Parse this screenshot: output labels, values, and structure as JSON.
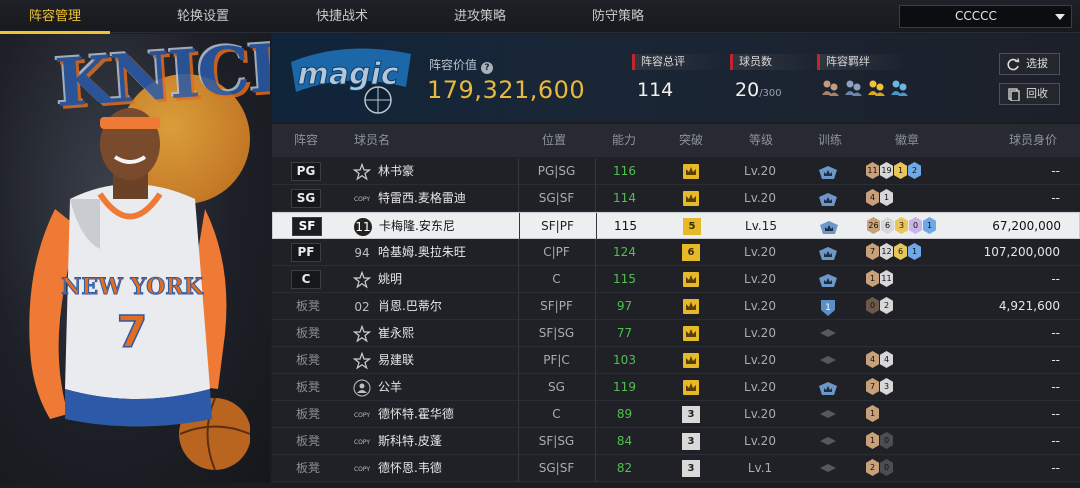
{
  "nav": {
    "tabs": [
      "阵容管理",
      "轮换设置",
      "快捷战术",
      "进攻策略",
      "防守策略"
    ],
    "active": 0,
    "team_select": "CCCCC"
  },
  "team": {
    "logo_text": "magic",
    "value_label": "阵容价值",
    "value": "179,321,600",
    "rating_label": "阵容总评",
    "rating": "114",
    "players_label": "球员数",
    "players_count": "20",
    "players_max": "/300",
    "bond_label": "阵容羁绊",
    "bond_icons": [
      "bond-gray-icon",
      "bond-blue-icon",
      "bond-yellow-icon",
      "bond-blue-icon"
    ],
    "btn_select": "选拔",
    "btn_recycle": "回收"
  },
  "table": {
    "headers": [
      "阵容",
      "球员名",
      "位置",
      "能力",
      "突破",
      "等级",
      "训练",
      "徽章",
      "球员身价"
    ],
    "rows": [
      {
        "slot": "PG",
        "icon": "star",
        "name": "林书豪",
        "pos": "PG|SG",
        "ability": "116",
        "break": "crown",
        "level": "Lv.20",
        "train": "blue",
        "badges": [
          [
            "11",
            "#c8a07a"
          ],
          [
            "19",
            "#d7d7d7"
          ],
          [
            "1",
            "#e8c65a"
          ],
          [
            "2",
            "#6ea8e6"
          ]
        ],
        "salary": "--"
      },
      {
        "slot": "SG",
        "icon": "copy",
        "name": "特雷西.麦格雷迪",
        "pos": "SG|SF",
        "ability": "114",
        "break": "crown",
        "level": "Lv.20",
        "train": "blue",
        "badges": [
          [
            "4",
            "#c8a07a"
          ],
          [
            "1",
            "#d7d7d7"
          ]
        ],
        "salary": "--"
      },
      {
        "slot": "SF",
        "icon": "11",
        "name": "卡梅隆.安东尼",
        "pos": "SF|PF",
        "ability": "115",
        "break": "5",
        "level": "Lv.15",
        "train": "blue",
        "badges": [
          [
            "26",
            "#c8a07a"
          ],
          [
            "6",
            "#d7d7d7"
          ],
          [
            "3",
            "#e8c65a"
          ],
          [
            "0",
            "#c9b6e8"
          ],
          [
            "1",
            "#6ea8e6"
          ]
        ],
        "salary": "67,200,000"
      },
      {
        "slot": "PF",
        "icon": "94",
        "name": "哈基姆.奥拉朱旺",
        "pos": "C|PF",
        "ability": "124",
        "break": "6",
        "level": "Lv.20",
        "train": "blue",
        "badges": [
          [
            "7",
            "#c8a07a"
          ],
          [
            "12",
            "#d7d7d7"
          ],
          [
            "6",
            "#e8c65a"
          ],
          [
            "1",
            "#6ea8e6"
          ]
        ],
        "salary": "107,200,000"
      },
      {
        "slot": "C",
        "icon": "star",
        "name": "姚明",
        "pos": "C",
        "ability": "115",
        "break": "crown",
        "level": "Lv.20",
        "train": "blue",
        "badges": [
          [
            "1",
            "#c8a07a"
          ],
          [
            "11",
            "#d7d7d7"
          ]
        ],
        "salary": "--"
      },
      {
        "slot": "板凳",
        "icon": "02",
        "name": "肖恩.巴蒂尔",
        "pos": "SF|PF",
        "ability": "97",
        "break": "crown",
        "level": "Lv.20",
        "train": "blue-1",
        "badges": [
          [
            "0",
            "#6b5a4a"
          ],
          [
            "2",
            "#d7d7d7"
          ]
        ],
        "salary": "4,921,600"
      },
      {
        "slot": "板凳",
        "icon": "star",
        "name": "崔永熙",
        "pos": "SF|SG",
        "ability": "77",
        "break": "crown",
        "level": "Lv.20",
        "train": "gray",
        "badges": [],
        "salary": "--"
      },
      {
        "slot": "板凳",
        "icon": "star",
        "name": "易建联",
        "pos": "PF|C",
        "ability": "103",
        "break": "crown",
        "level": "Lv.20",
        "train": "gray",
        "badges": [
          [
            "4",
            "#c8a07a"
          ],
          [
            "4",
            "#d7d7d7"
          ]
        ],
        "salary": "--"
      },
      {
        "slot": "板凳",
        "icon": "person",
        "name": "公羊",
        "pos": "SG",
        "ability": "119",
        "break": "crown",
        "level": "Lv.20",
        "train": "blue",
        "badges": [
          [
            "7",
            "#c8a07a"
          ],
          [
            "3",
            "#d7d7d7"
          ]
        ],
        "salary": "--"
      },
      {
        "slot": "板凳",
        "icon": "copy",
        "name": "德怀特.霍华德",
        "pos": "C",
        "ability": "89",
        "break": "3",
        "level": "Lv.20",
        "train": "gray",
        "badges": [
          [
            "1",
            "#c8a07a"
          ]
        ],
        "salary": "--"
      },
      {
        "slot": "板凳",
        "icon": "copy",
        "name": "斯科特.皮蓬",
        "pos": "SF|SG",
        "ability": "84",
        "break": "3",
        "level": "Lv.20",
        "train": "gray",
        "badges": [
          [
            "1",
            "#c8a07a"
          ],
          [
            "0",
            "#4a4d52"
          ]
        ],
        "salary": "--"
      },
      {
        "slot": "板凳",
        "icon": "copy",
        "name": "德怀恩.韦德",
        "pos": "SG|SF",
        "ability": "82",
        "break": "3",
        "level": "Lv.1",
        "train": "gray",
        "badges": [
          [
            "2",
            "#c8a07a"
          ],
          [
            "0",
            "#4a4d52"
          ]
        ],
        "salary": "--"
      }
    ],
    "selected_row": 2
  },
  "player_card": {
    "jersey_text": "NEW YORK",
    "jersey_number": "7",
    "logo_text": "KNICKS"
  },
  "colors": {
    "accent": "#f1c232",
    "value_gold": "#e8b93a",
    "ability_green": "#4fc14f",
    "bond_red": "#c0272d"
  }
}
